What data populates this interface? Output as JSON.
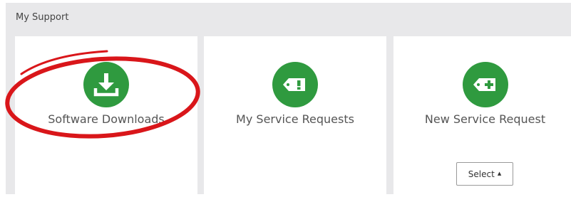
{
  "panel": {
    "title": "My Support"
  },
  "cards": [
    {
      "label": "Software Downloads",
      "icon": "download-icon"
    },
    {
      "label": "My Service Requests",
      "icon": "ticket-alert-icon"
    },
    {
      "label": "New Service Request",
      "icon": "ticket-add-icon"
    }
  ],
  "select_button": {
    "label": "Select",
    "caret": "▲"
  },
  "colors": {
    "icon_green": "#2f9a3f",
    "highlight_red": "#d9161a",
    "panel_bg": "#e8e8ea"
  }
}
